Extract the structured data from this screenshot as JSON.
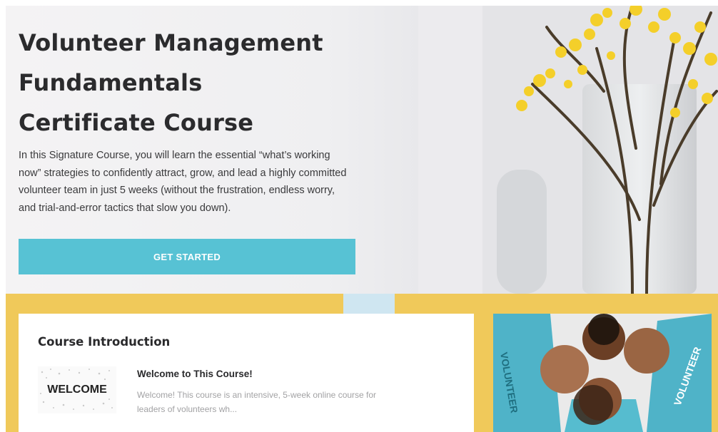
{
  "hero": {
    "title_lines": [
      "Volunteer Management",
      "Fundamentals",
      "Certificate Course"
    ],
    "description": "In this Signature Course, you will learn the essential “what’s working now” strategies to confidently attract, grow, and lead a highly committed volunteer team in just 5 weeks (without the frustration, endless worry, and trial-and-error tactics that slow you down).",
    "cta_label": "GET STARTED",
    "image_icon": "flower-vase-image"
  },
  "course": {
    "section_title": "Course Introduction",
    "lessons": [
      {
        "thumb_text": "WELCOME",
        "title": "Welcome to This Course!",
        "description": "Welcome! This course is an intensive, 5-week online course for leaders of volunteers wh..."
      }
    ]
  },
  "side_image": {
    "icon": "volunteer-group-photo",
    "shirt_text": [
      "VOLUNTEER",
      "VOLUNTEER"
    ]
  },
  "colors": {
    "accent": "#57c2d4",
    "band": "#f0c95a",
    "heading": "#2b2b2d"
  }
}
